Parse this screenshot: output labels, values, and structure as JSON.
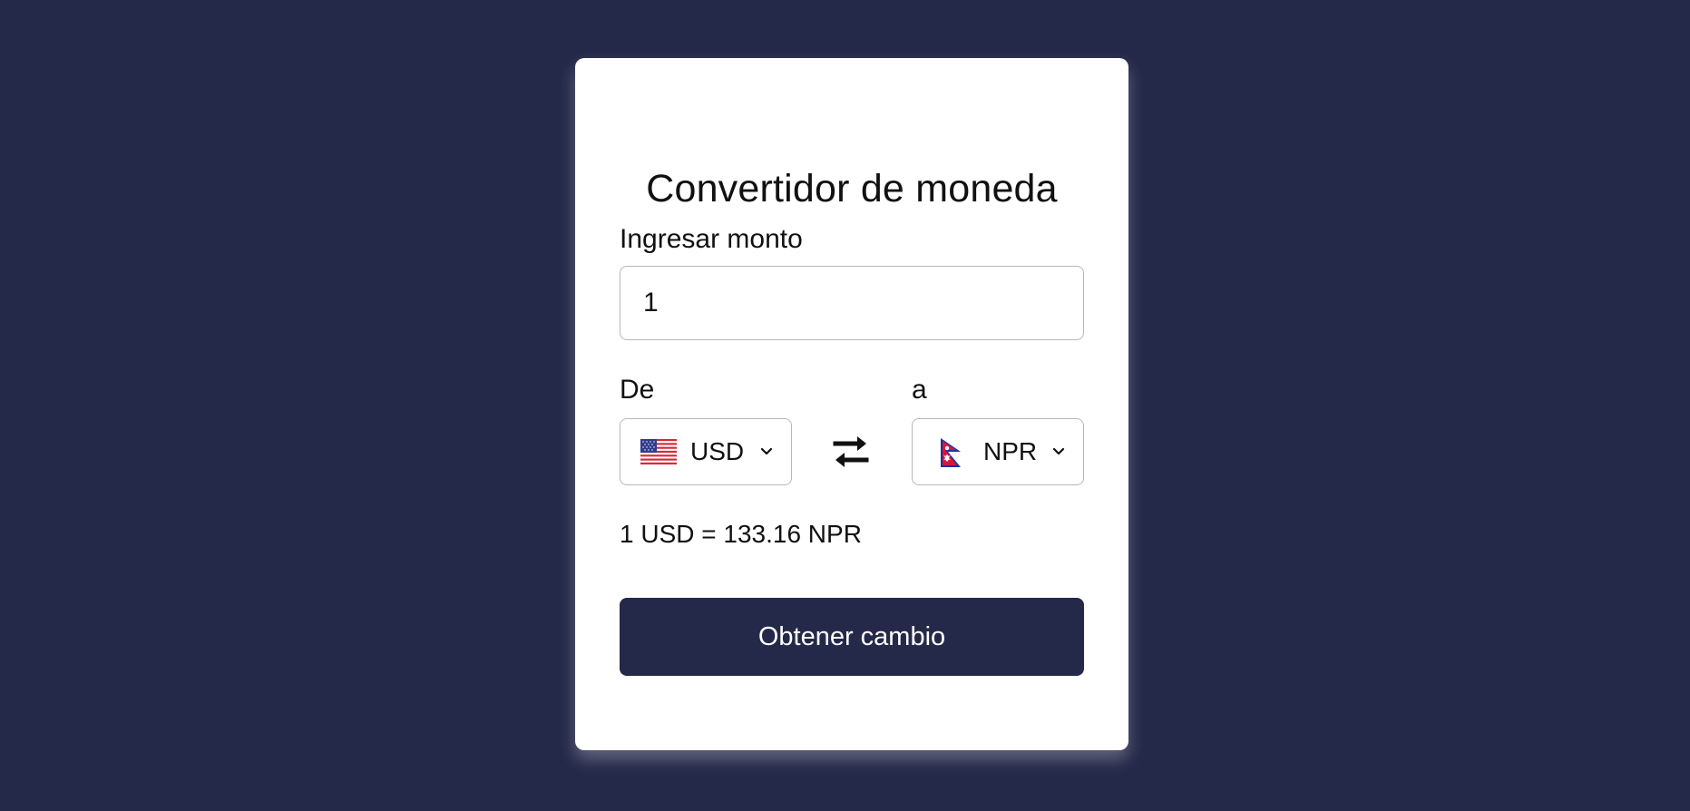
{
  "app": {
    "title": "Convertidor de moneda"
  },
  "amount": {
    "label": "Ingresar monto",
    "value": "1"
  },
  "from": {
    "label": "De",
    "currency": "USD",
    "flag": "united-states-flag-icon"
  },
  "to": {
    "label": "a",
    "currency": "NPR",
    "flag": "nepal-flag-icon"
  },
  "rate": {
    "text": "1 USD = 133.16 NPR"
  },
  "button": {
    "label": "Obtener cambio"
  },
  "icons": {
    "swap": "swap-arrows-icon",
    "chevron": "chevron-down-icon"
  },
  "colors": {
    "background": "#252949",
    "card": "#ffffff",
    "button": "#252949",
    "button_text": "#ffffff",
    "border": "#b8b8b8"
  }
}
